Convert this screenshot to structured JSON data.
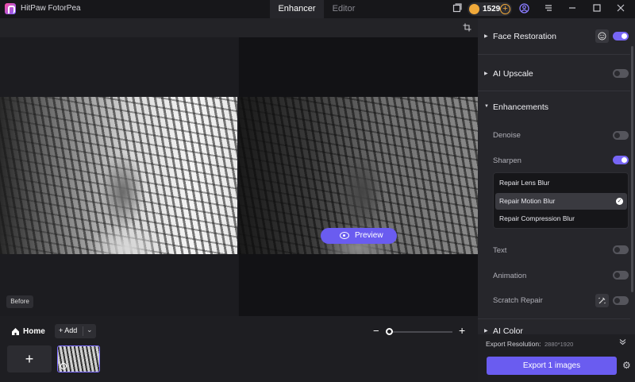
{
  "app": {
    "title": "HitPaw FotorPea"
  },
  "tabs": [
    {
      "label": "Enhancer",
      "active": true
    },
    {
      "label": "Editor",
      "active": false
    }
  ],
  "credits": {
    "count": "1529"
  },
  "canvas": {
    "preview_label": "Preview",
    "before_label": "Before"
  },
  "bottom": {
    "home_label": "Home",
    "add_label": "Add",
    "zoom_minus": "−",
    "zoom_plus": "+",
    "add_tile": "+"
  },
  "panel": {
    "face_restoration": {
      "label": "Face Restoration",
      "enabled": true
    },
    "ai_upscale": {
      "label": "AI Upscale",
      "enabled": false
    },
    "enhancements": {
      "label": "Enhancements",
      "denoise": {
        "label": "Denoise",
        "enabled": false
      },
      "sharpen": {
        "label": "Sharpen",
        "enabled": true
      },
      "sharpen_options": [
        {
          "label": "Repair Lens Blur",
          "selected": false
        },
        {
          "label": "Repair Motion Blur",
          "selected": true
        },
        {
          "label": "Repair Compression Blur",
          "selected": false
        }
      ],
      "text": {
        "label": "Text",
        "enabled": false
      },
      "animation": {
        "label": "Animation",
        "enabled": false
      },
      "scratch_repair": {
        "label": "Scratch Repair",
        "enabled": false
      }
    },
    "ai_color": {
      "label": "AI Color"
    },
    "export": {
      "resolution_label": "Export Resolution:",
      "resolution_value": "2880*1920",
      "button_label": "Export 1 images"
    }
  },
  "colors": {
    "accent": "#6a5cf0",
    "toggle_on": "#7766f5",
    "coin": "#f0a93a"
  }
}
